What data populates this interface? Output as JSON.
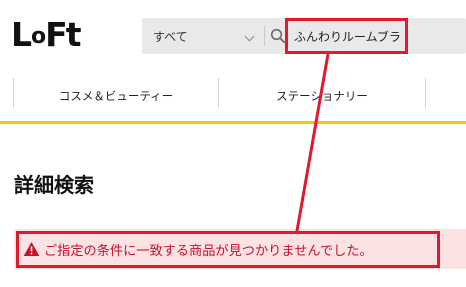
{
  "header": {
    "logo_text": "LoFt",
    "search": {
      "category_value": "すべて",
      "query_value": "ふんわりルームブラ"
    }
  },
  "nav": {
    "items": [
      {
        "label": "コスメ＆ビューティー"
      },
      {
        "label": "ステーショナリー"
      }
    ]
  },
  "main": {
    "title": "詳細検索",
    "alert_message": "ご指定の条件に一致する商品が見つかりませんでした。"
  },
  "colors": {
    "accent_yellow": "#f5c800",
    "alert_text": "#c8102e",
    "alert_bg": "#fbe3e3",
    "highlight_red": "#e01a2c"
  },
  "icons": [
    "search-icon",
    "chevron-down-icon",
    "warning-icon"
  ]
}
